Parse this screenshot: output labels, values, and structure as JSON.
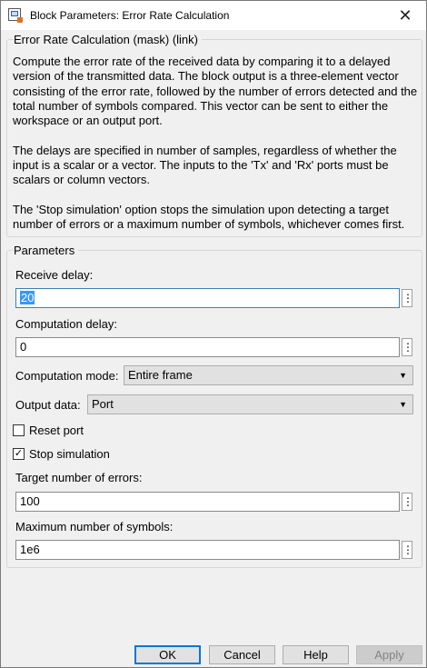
{
  "window": {
    "title": "Block Parameters: Error Rate Calculation"
  },
  "mask_group": {
    "title": "Error Rate Calculation (mask) (link)",
    "paragraphs": [
      "Compute the error rate of the received data by comparing it to a delayed version of the transmitted data. The block output is a three-element vector consisting of the error rate, followed by the number of errors detected and the total number of symbols compared. This vector can be sent to either the workspace or an output port.",
      "The delays are specified in number of samples, regardless of whether the input is a scalar or a vector. The inputs to the 'Tx' and 'Rx' ports must be scalars or column vectors.",
      "The 'Stop simulation' option stops the simulation upon detecting a target number of errors or a maximum number of symbols, whichever comes first."
    ]
  },
  "parameters": {
    "title": "Parameters",
    "receive_delay": {
      "label": "Receive delay:",
      "value": "20"
    },
    "computation_delay": {
      "label": "Computation delay:",
      "value": "0"
    },
    "computation_mode": {
      "label": "Computation mode:",
      "value": "Entire frame"
    },
    "output_data": {
      "label": "Output data:",
      "value": "Port"
    },
    "reset_port": {
      "label": "Reset port",
      "checked": false
    },
    "stop_simulation": {
      "label": "Stop simulation",
      "checked": true
    },
    "target_errors": {
      "label": "Target number of errors:",
      "value": "100"
    },
    "max_symbols": {
      "label": "Maximum number of symbols:",
      "value": "1e6"
    }
  },
  "buttons": {
    "ok": "OK",
    "cancel": "Cancel",
    "help": "Help",
    "apply": "Apply"
  },
  "icons": {
    "kebab": "more-options-icon",
    "close": "close-icon",
    "dropdown": "chevron-down-icon"
  }
}
